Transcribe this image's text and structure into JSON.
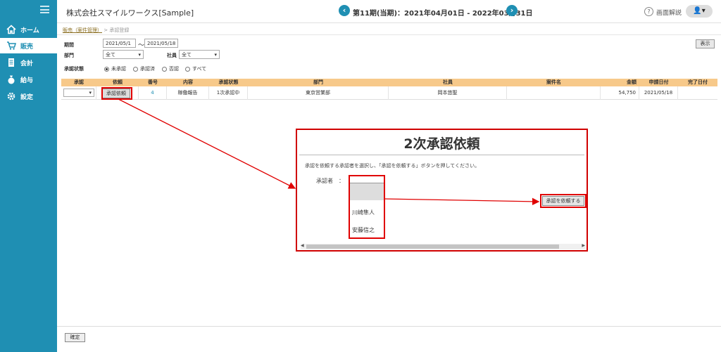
{
  "header": {
    "company": "株式会社スマイルワークス[Sample]",
    "period": "第11期(当期)：2021年04月01日 - 2022年03月31日",
    "prev_symbol": "‹",
    "next_symbol": "›",
    "help_label": "画面解説",
    "user_symbol": "👤▾"
  },
  "sidebar": {
    "items": [
      {
        "label": "ホーム",
        "icon": "home-icon"
      },
      {
        "label": "販売",
        "icon": "cart-icon"
      },
      {
        "label": "会計",
        "icon": "ledger-icon"
      },
      {
        "label": "給与",
        "icon": "money-bag-icon"
      },
      {
        "label": "設定",
        "icon": "gear-icon"
      }
    ]
  },
  "breadcrumb": {
    "link": "販売（案件管理）",
    "current": "> 承認登録"
  },
  "filters": {
    "period_label": "期間",
    "from": "2021/05/1",
    "tilde": "～",
    "to": "2021/05/18",
    "dept_label": "部門",
    "dept_value": "全て",
    "employee_label": "社員",
    "employee_value": "全て",
    "status_label": "承認状態",
    "status_options": [
      "未承認",
      "承認済",
      "否認",
      "すべて"
    ],
    "show_button": "表示"
  },
  "table": {
    "headers": [
      "承認",
      "依頼",
      "番号",
      "内容",
      "承認状態",
      "部門",
      "社員",
      "案件名",
      "金額",
      "申請日付",
      "完了日付"
    ],
    "row": {
      "request_button": "承認依頼",
      "number": "4",
      "content": "稼働報告",
      "status": "1次承認中",
      "dept": "東京営業部",
      "employee": "岡本悠聖",
      "project": "",
      "amount": "54,750",
      "apply_date": "2021/05/18",
      "done_date": ""
    }
  },
  "dialog": {
    "title": "2次承認依頼",
    "description": "承認を依頼する承認者を選択し、「承認を依頼する」ボタンを押してください。",
    "approver_label": "承認者　：",
    "options": [
      "川崎隼人",
      "安藤信之"
    ],
    "submit_button": "承認を依頼する"
  },
  "footer": {
    "confirm_button": "確定"
  },
  "colors": {
    "sidebar": "#1f8fb3",
    "table_header": "#f7c98a",
    "highlight": "#e00000"
  }
}
